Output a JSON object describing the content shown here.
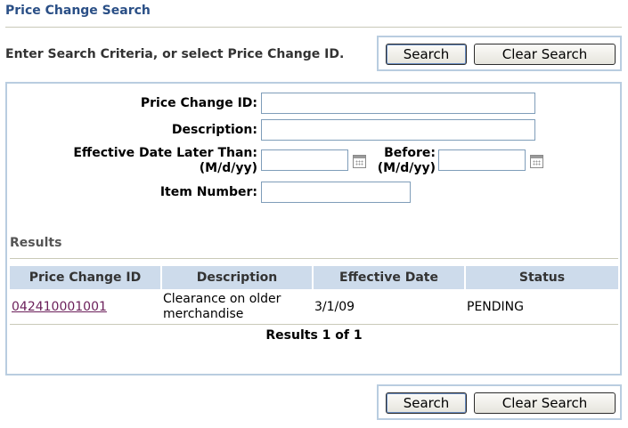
{
  "page_title": "Price Change Search",
  "instructions": "Enter Search Criteria, or select Price Change ID.",
  "buttons": {
    "search_label": "Search",
    "clear_label": "Clear Search"
  },
  "form": {
    "price_change_id_label": "Price Change ID:",
    "price_change_id_value": "",
    "description_label": "Description:",
    "description_value": "",
    "eff_date_later_label_line1": "Effective Date Later Than:",
    "eff_date_later_label_line2": "(M/d/yy)",
    "eff_date_later_value": "",
    "before_label_line1": "Before:",
    "before_label_line2": "(M/d/yy)",
    "before_value": "",
    "item_number_label": "Item Number:",
    "item_number_value": ""
  },
  "results": {
    "section_label": "Results",
    "columns": [
      "Price Change ID",
      "Description",
      "Effective Date",
      "Status"
    ],
    "rows": [
      {
        "price_change_id": "042410001001",
        "description": "Clearance on older merchandise",
        "effective_date": "3/1/09",
        "status": "PENDING"
      }
    ],
    "count_text": "Results 1 of 1"
  }
}
